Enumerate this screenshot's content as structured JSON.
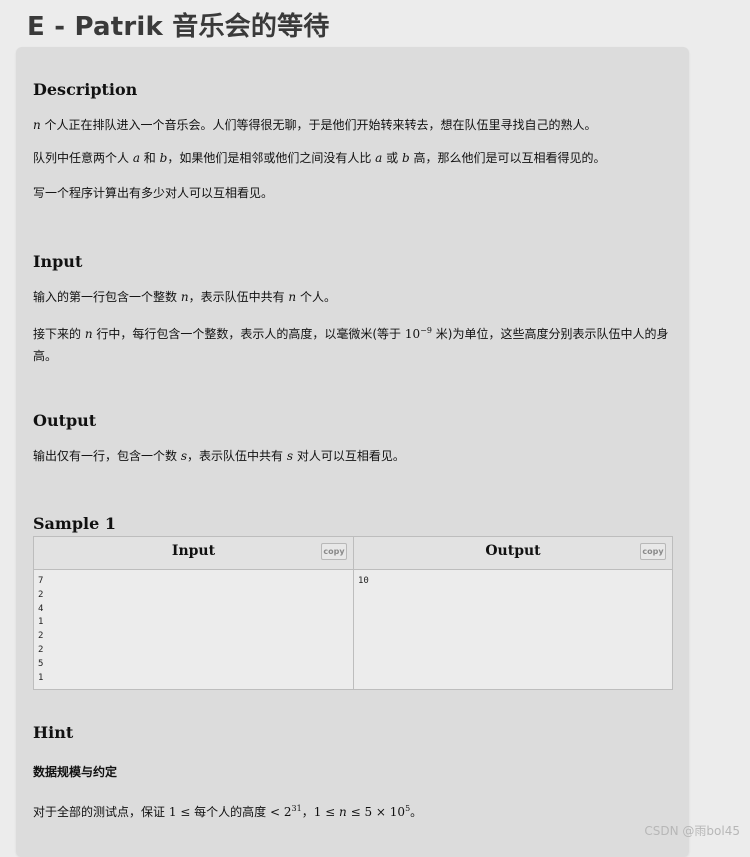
{
  "title": "E - Patrik 音乐会的等待",
  "sections": {
    "description": {
      "heading": "Description",
      "p1_pre": "",
      "p1_var": "n",
      "p1_post": " 个人正在排队进入一个音乐会。人们等得很无聊，于是他们开始转来转去，想在队伍里寻找自己的熟人。",
      "p2_a": "队列中任意两个人 ",
      "p2_var_a": "a",
      "p2_b": " 和 ",
      "p2_var_b": "b",
      "p2_c": "，如果他们是相邻或他们之间没有人比 ",
      "p2_var_a2": "a",
      "p2_d": " 或 ",
      "p2_var_b2": "b",
      "p2_e": " 高，那么他们是可以互相看得见的。",
      "p3": "写一个程序计算出有多少对人可以互相看见。"
    },
    "input": {
      "heading": "Input",
      "p1_a": "输入的第一行包含一个整数 ",
      "p1_var": "n",
      "p1_b": "，表示队伍中共有 ",
      "p1_var2": "n",
      "p1_c": " 个人。",
      "p2_a": "接下来的 ",
      "p2_var": "n",
      "p2_b": " 行中，每行包含一个整数，表示人的高度，以毫微米(等于 ",
      "p2_base": "10",
      "p2_exp": "−9",
      "p2_c": " 米)为单位，这些高度分别表示队伍中人的身高。"
    },
    "output": {
      "heading": "Output",
      "p1_a": "输出仅有一行，包含一个数 ",
      "p1_var": "s",
      "p1_b": "，表示队伍中共有 ",
      "p1_var2": "s",
      "p1_c": " 对人可以互相看见。"
    },
    "sample": {
      "heading": "Sample 1",
      "input_label": "Input",
      "output_label": "Output",
      "copy_label": "copy",
      "input_text": "7\n2\n4\n1\n2\n2\n5\n1",
      "output_text": "10"
    },
    "hint": {
      "heading": "Hint",
      "subheading": "数据规模与约定",
      "p1_a": "对于全部的测试点，保证 ",
      "p1_one": "1",
      "p1_le": " ≤ ",
      "p1_b": "每个人的高度",
      "p1_lt": " < ",
      "p1_two": "2",
      "p1_exp31": "31",
      "p1_c": "，",
      "p1_one2": "1",
      "p1_le2": " ≤ ",
      "p1_n": "n",
      "p1_le3": " ≤ ",
      "p1_five": "5",
      "p1_times": " × ",
      "p1_ten": "10",
      "p1_exp5": "5",
      "p1_end": "。"
    }
  },
  "watermark": "CSDN @雨bol45"
}
